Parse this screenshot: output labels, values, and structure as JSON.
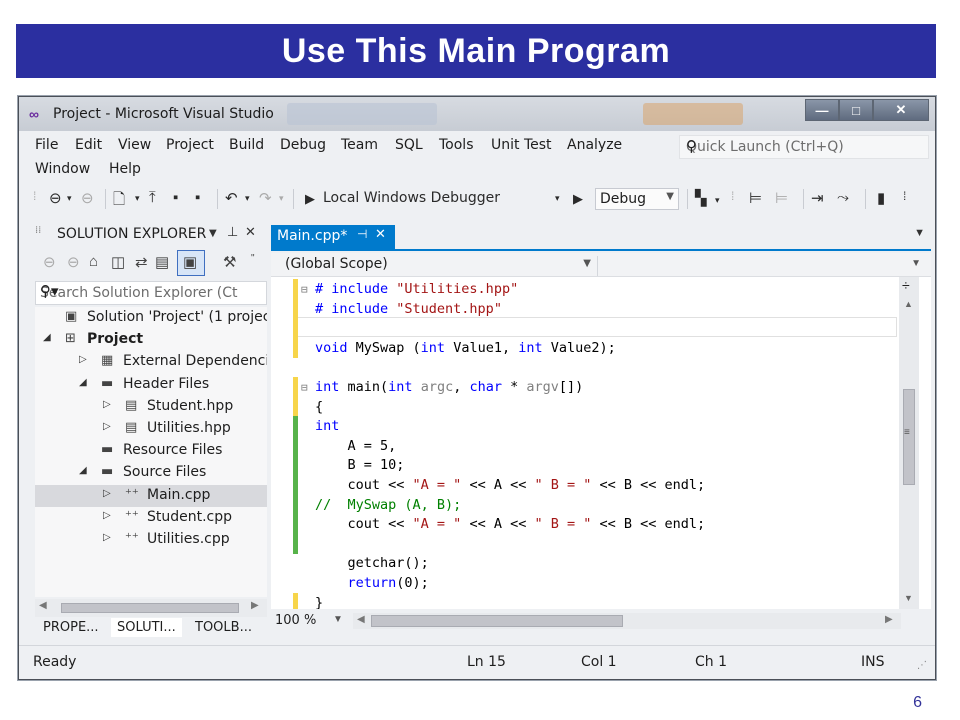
{
  "slide": {
    "title": "Use This Main Program",
    "page_number": "6"
  },
  "window": {
    "title": "Project - Microsoft Visual Studio",
    "controls": {
      "minimize": "—",
      "maximize": "□",
      "close": "✕"
    }
  },
  "menu": {
    "items": [
      "File",
      "Edit",
      "View",
      "Project",
      "Build",
      "Debug",
      "Team",
      "SQL",
      "Tools",
      "Unit Test",
      "Analyze",
      "Window",
      "Help"
    ]
  },
  "quick_launch": {
    "placeholder": "Quick Launch (Ctrl+Q)"
  },
  "toolbar": {
    "debugger_label": "Local Windows Debugger",
    "configuration": "Debug"
  },
  "solution_explorer": {
    "title": "SOLUTION EXPLORER",
    "search_placeholder": "Search Solution Explorer (Ct",
    "tree": [
      {
        "label": "Solution 'Project' (1 project)",
        "depth": 0,
        "twisty": "",
        "icon": "solution-icon",
        "bold": false,
        "selected": false
      },
      {
        "label": "Project",
        "depth": 0,
        "twisty": "◢",
        "icon": "project-icon",
        "bold": true,
        "selected": false
      },
      {
        "label": "External Dependencies",
        "depth": 1,
        "twisty": "▷",
        "icon": "dependencies-icon",
        "bold": false,
        "selected": false
      },
      {
        "label": "Header Files",
        "depth": 1,
        "twisty": "◢",
        "icon": "folder-icon",
        "bold": false,
        "selected": false
      },
      {
        "label": "Student.hpp",
        "depth": 2,
        "twisty": "▷",
        "icon": "header-file-icon",
        "bold": false,
        "selected": false
      },
      {
        "label": "Utilities.hpp",
        "depth": 2,
        "twisty": "▷",
        "icon": "header-file-icon",
        "bold": false,
        "selected": false
      },
      {
        "label": "Resource Files",
        "depth": 1,
        "twisty": "",
        "icon": "folder-icon",
        "bold": false,
        "selected": false
      },
      {
        "label": "Source Files",
        "depth": 1,
        "twisty": "◢",
        "icon": "folder-icon",
        "bold": false,
        "selected": false
      },
      {
        "label": "Main.cpp",
        "depth": 2,
        "twisty": "▷",
        "icon": "cpp-file-icon",
        "bold": false,
        "selected": true
      },
      {
        "label": "Student.cpp",
        "depth": 2,
        "twisty": "▷",
        "icon": "cpp-file-icon",
        "bold": false,
        "selected": false
      },
      {
        "label": "Utilities.cpp",
        "depth": 2,
        "twisty": "▷",
        "icon": "cpp-file-icon",
        "bold": false,
        "selected": false
      }
    ],
    "bottom_tabs": [
      "PROPE...",
      "SOLUTI...",
      "TOOLB..."
    ]
  },
  "editor": {
    "tab_label": "Main.cpp*",
    "scope": "(Global Scope)",
    "zoom": "100 %",
    "lines": [
      {
        "fold": "⊟",
        "parts": [
          [
            "pp",
            "# include "
          ],
          [
            "str",
            "\"Utilities.hpp\""
          ]
        ],
        "bar": "#f7d54a"
      },
      {
        "fold": "",
        "parts": [
          [
            "pp",
            "# include "
          ],
          [
            "str",
            "\"Student.hpp\""
          ]
        ],
        "bar": "#f7d54a"
      },
      {
        "fold": "",
        "parts": [],
        "bar": "#f7d54a"
      },
      {
        "fold": "",
        "parts": [
          [
            "kw",
            "void"
          ],
          [
            "",
            " MySwap ("
          ],
          [
            "kw",
            "int"
          ],
          [
            "",
            " Value1, "
          ],
          [
            "kw",
            "int"
          ],
          [
            "",
            " Value2);"
          ]
        ],
        "bar": "#f7d54a"
      },
      {
        "fold": "",
        "parts": [],
        "bar": ""
      },
      {
        "fold": "⊟",
        "parts": [
          [
            "kw",
            "int"
          ],
          [
            "",
            " main("
          ],
          [
            "kw",
            "int"
          ],
          [
            "prm",
            " argc"
          ],
          [
            "",
            ", "
          ],
          [
            "kw",
            "char"
          ],
          [
            "",
            " * "
          ],
          [
            "prm",
            "argv"
          ],
          [
            "",
            "[])"
          ]
        ],
        "bar": "#f7d54a"
      },
      {
        "fold": "",
        "parts": [
          [
            "",
            "{"
          ]
        ],
        "bar": "#f7d54a"
      },
      {
        "fold": "",
        "parts": [
          [
            "kw",
            "int"
          ]
        ],
        "bar": "#57b34a"
      },
      {
        "fold": "",
        "parts": [
          [
            "",
            "    A = 5,"
          ]
        ],
        "bar": "#57b34a"
      },
      {
        "fold": "",
        "parts": [
          [
            "",
            "    B = 10;"
          ]
        ],
        "bar": "#57b34a"
      },
      {
        "fold": "",
        "parts": [
          [
            "",
            "    cout << "
          ],
          [
            "str",
            "\"A = \""
          ],
          [
            "",
            " << A << "
          ],
          [
            "str",
            "\" B = \""
          ],
          [
            "",
            " << B << endl;"
          ]
        ],
        "bar": "#57b34a"
      },
      {
        "fold": "",
        "parts": [
          [
            "cmt",
            "//  MySwap (A, B);"
          ]
        ],
        "bar": "#57b34a"
      },
      {
        "fold": "",
        "parts": [
          [
            "",
            "    cout << "
          ],
          [
            "str",
            "\"A = \""
          ],
          [
            "",
            " << A << "
          ],
          [
            "str",
            "\" B = \""
          ],
          [
            "",
            " << B << endl;"
          ]
        ],
        "bar": "#57b34a"
      },
      {
        "fold": "",
        "parts": [],
        "bar": "#57b34a"
      },
      {
        "fold": "",
        "parts": [
          [
            "",
            "    getchar();"
          ]
        ],
        "bar": ""
      },
      {
        "fold": "",
        "parts": [
          [
            "",
            "    "
          ],
          [
            "kw",
            "return"
          ],
          [
            "",
            "(0);"
          ]
        ],
        "bar": ""
      },
      {
        "fold": "",
        "parts": [
          [
            "",
            "}"
          ]
        ],
        "bar": "#f7d54a"
      }
    ]
  },
  "status": {
    "state": "Ready",
    "line": "Ln 15",
    "col": "Col 1",
    "ch": "Ch 1",
    "mode": "INS"
  },
  "colors": {
    "title_bar": "#2b2fa0",
    "accent": "#007acc",
    "saved_change": "#57b34a",
    "unsaved_change": "#f7d54a"
  }
}
